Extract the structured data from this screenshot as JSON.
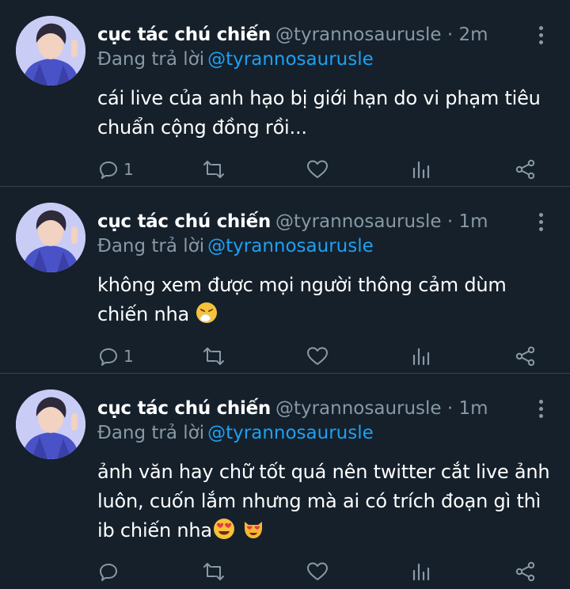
{
  "tweets": [
    {
      "name": "cục tác chú chiến",
      "handle": "@tyrannosaurusle · 2m",
      "reply_prefix": "Đang trả lời",
      "reply_handle": "@tyrannosaurusle",
      "text": "cái live của anh hạo bị giới hạn do vi phạm tiêu chuẩn cộng đồng rồi...",
      "emojis": [],
      "reply_count": "1",
      "icons": [
        "comment-icon",
        "retweet-icon",
        "heart-icon",
        "analytics-icon",
        "share-icon",
        "more-icon"
      ]
    },
    {
      "name": "cục tác chú chiến",
      "handle": "@tyrannosaurusle · 1m",
      "reply_prefix": "Đang trả lời",
      "reply_handle": "@tyrannosaurusle",
      "text": "không xem được mọi người thông cảm dùm chiến nha",
      "emojis": [
        "sneezing-face-emoji"
      ],
      "reply_count": "1",
      "icons": [
        "comment-icon",
        "retweet-icon",
        "heart-icon",
        "analytics-icon",
        "share-icon",
        "more-icon"
      ]
    },
    {
      "name": "cục tác chú chiến",
      "handle": "@tyrannosaurusle · 1m",
      "reply_prefix": "Đang trả lời",
      "reply_handle": "@tyrannosaurusle",
      "text": "ảnh văn hay chữ tốt quá nên twitter cắt live ảnh luôn, cuốn lắm nhưng mà ai có trích đoạn gì thì ib chiến nha",
      "emojis": [
        "heart-eyes-emoji",
        "heart-eyes-cat-emoji"
      ],
      "reply_count": "",
      "icons": [
        "comment-icon",
        "retweet-icon",
        "heart-icon",
        "analytics-icon",
        "share-icon",
        "more-icon"
      ]
    }
  ],
  "colors": {
    "background": "#15202b",
    "text_primary": "#ffffff",
    "text_secondary": "#8899a6",
    "link": "#1da1f2",
    "divider": "#38444d"
  }
}
